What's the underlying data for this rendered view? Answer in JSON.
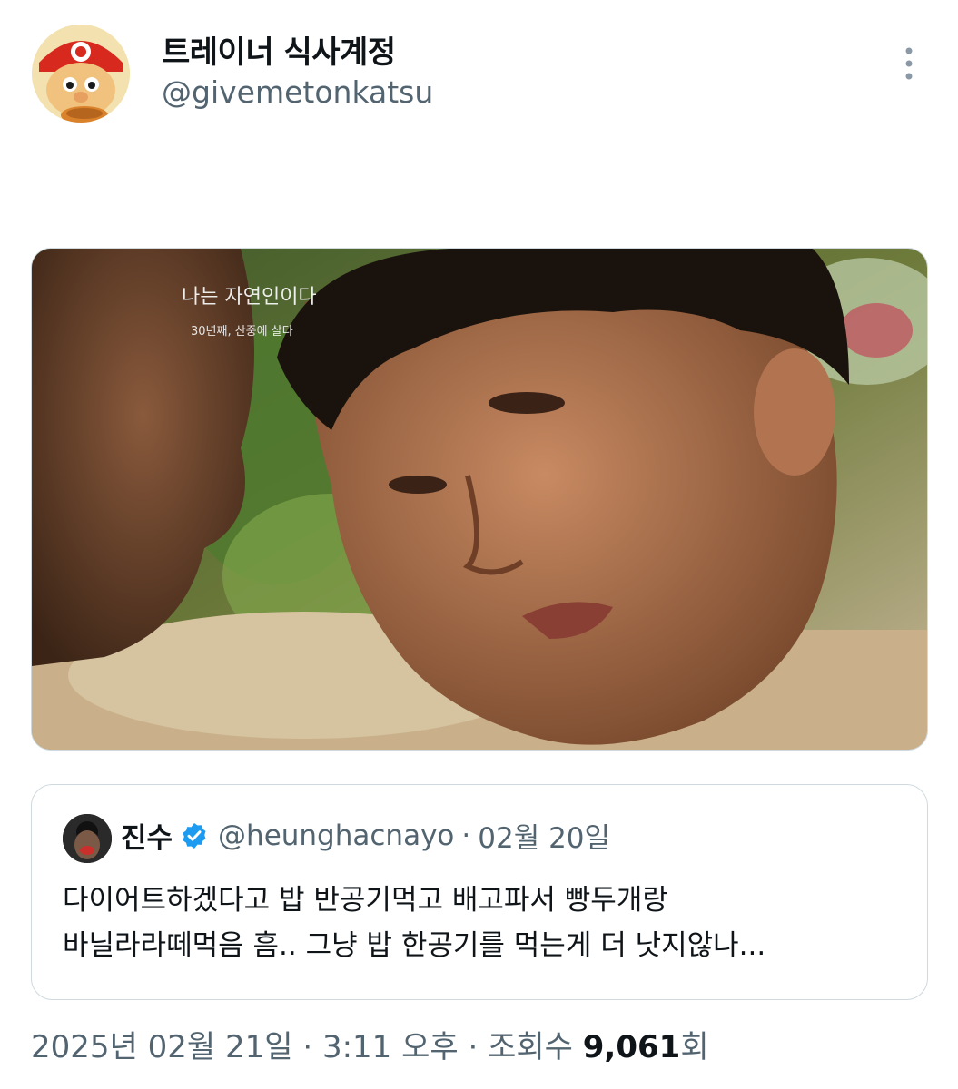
{
  "author": {
    "display_name": "트레이너 식사계정",
    "handle": "@givemetonkatsu",
    "avatar_icon": "mario-avatar-icon"
  },
  "more_icon": "more-vertical-icon",
  "media": {
    "overlay_title": "나는 자연인이다",
    "overlay_subtitle": "30년째, 산중에 살다"
  },
  "quote": {
    "author_name": "진수",
    "verified_icon": "verified-badge-icon",
    "handle": "@heunghacnayo",
    "separator": "·",
    "date": "02월 20일",
    "text_line1": "다이어트하겠다고 밥 반공기먹고 배고파서 빵두개랑",
    "text_line2": "바닐라라떼먹음 흠.. 그냥 밥 한공기를 먹는게 더 낫지않나..."
  },
  "footer": {
    "date": "2025년 02월 21일",
    "sep1": " · ",
    "time": "3:11 오후",
    "sep2": " · ",
    "views_label": "조회수 ",
    "views_count": "9,061",
    "views_suffix": "회"
  },
  "colors": {
    "text_primary": "#0f1419",
    "text_secondary": "#536471",
    "border": "#cfd9de",
    "verified_blue": "#1d9bf0"
  }
}
